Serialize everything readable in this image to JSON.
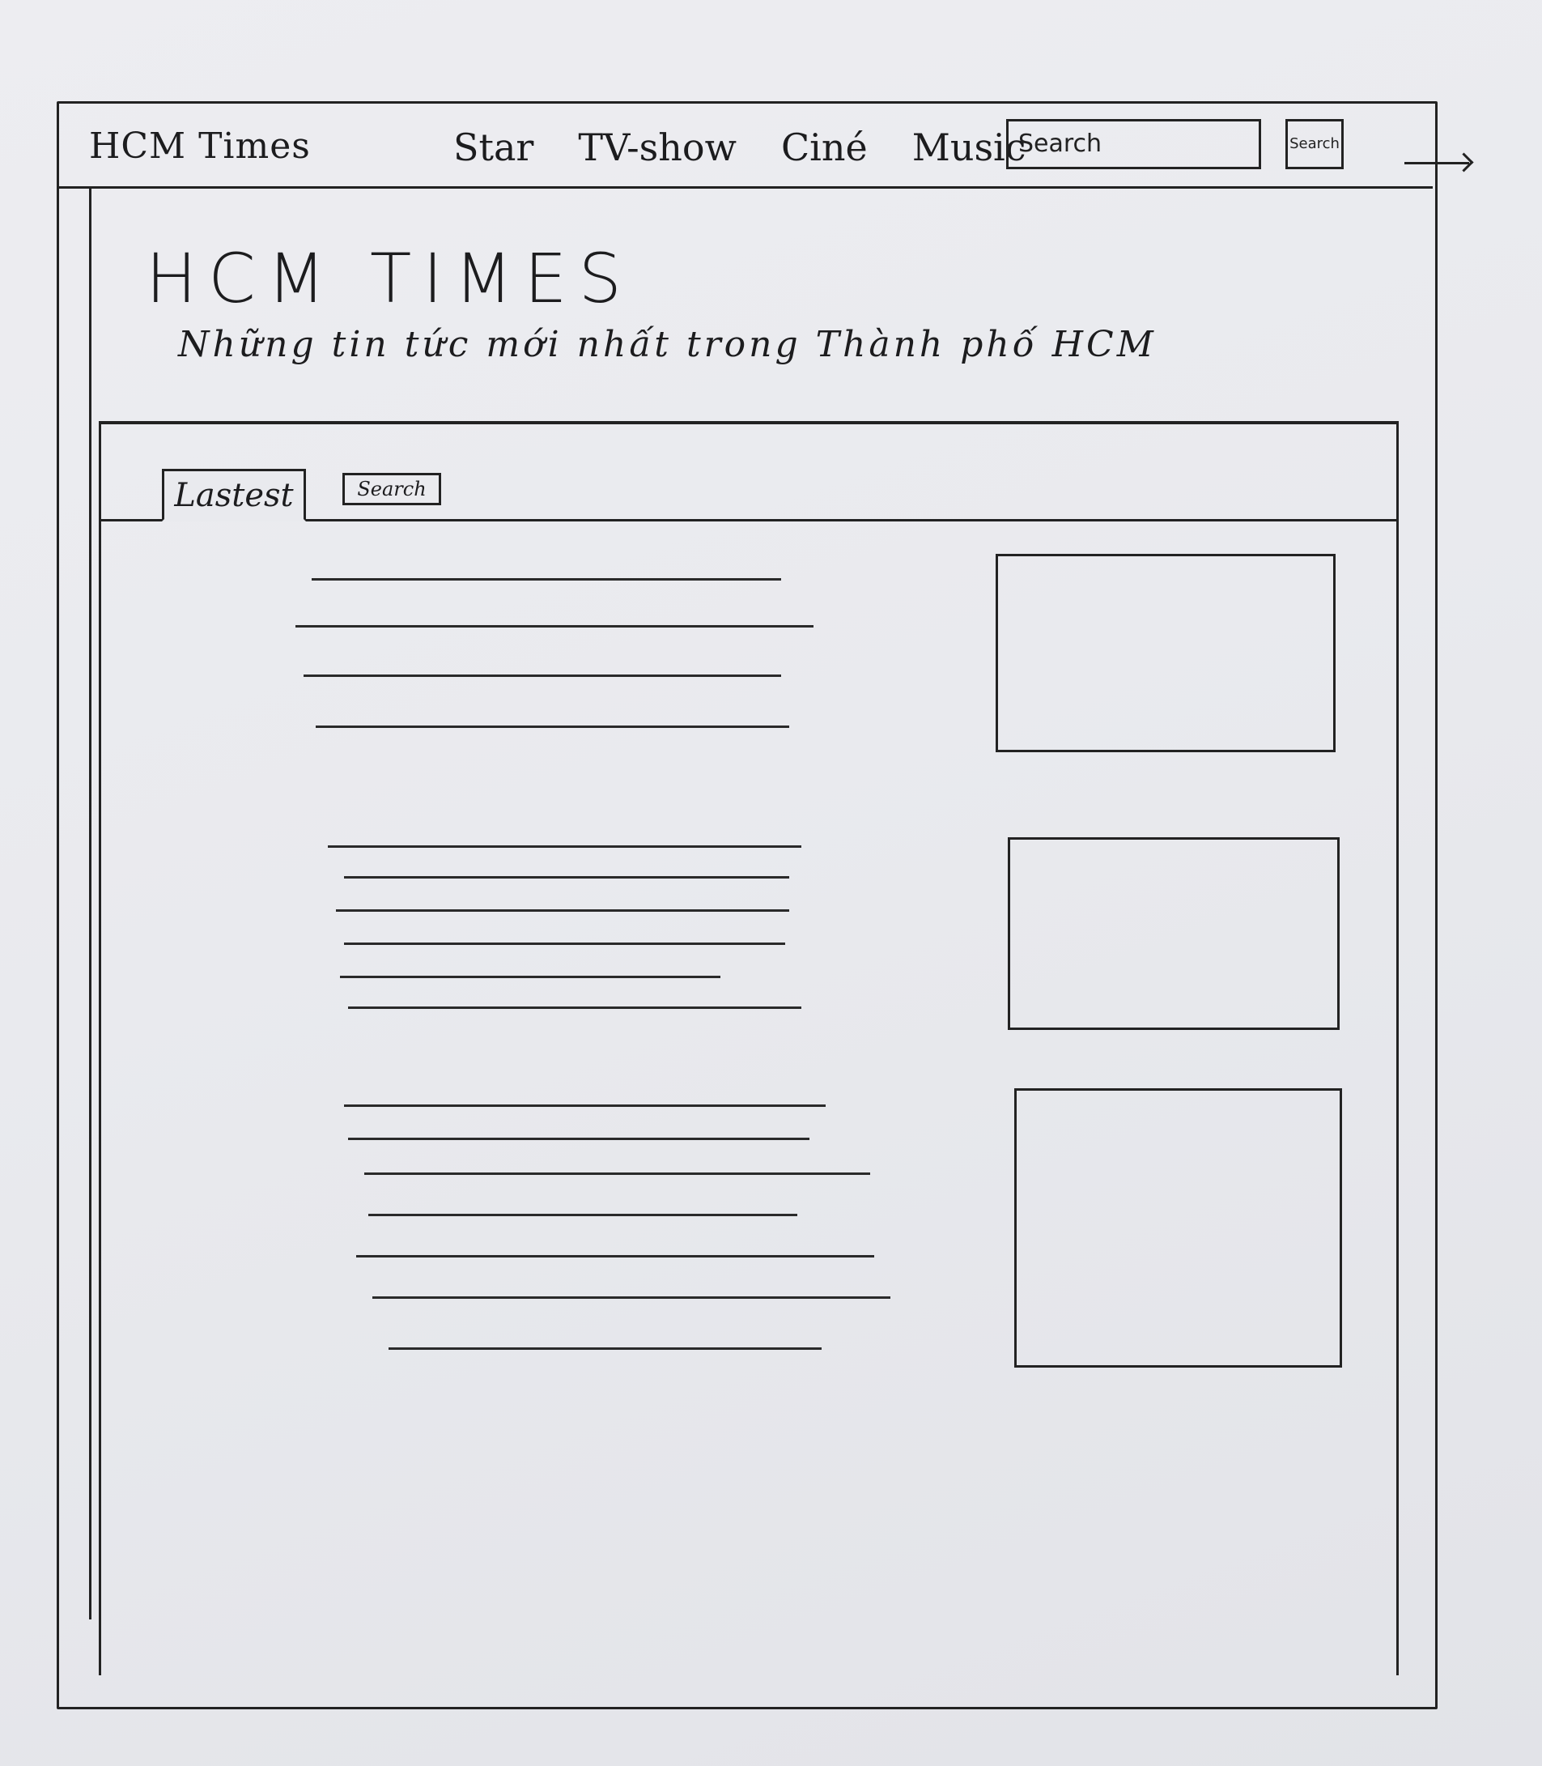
{
  "navbar": {
    "brand": "HCM Times",
    "links": [
      "Star",
      "TV-show",
      "Ciné",
      "Music"
    ],
    "search_placeholder": "Search",
    "search_button": "Search"
  },
  "hero": {
    "title": "HCM TIMES",
    "subtitle": "Những tin tức mới nhất trong Thành phố HCM"
  },
  "tabs": [
    "Lastest",
    "Search"
  ],
  "articles": [
    {
      "line_count": 4
    },
    {
      "line_count": 6
    },
    {
      "line_count": 7
    }
  ],
  "thumbnails": 3
}
